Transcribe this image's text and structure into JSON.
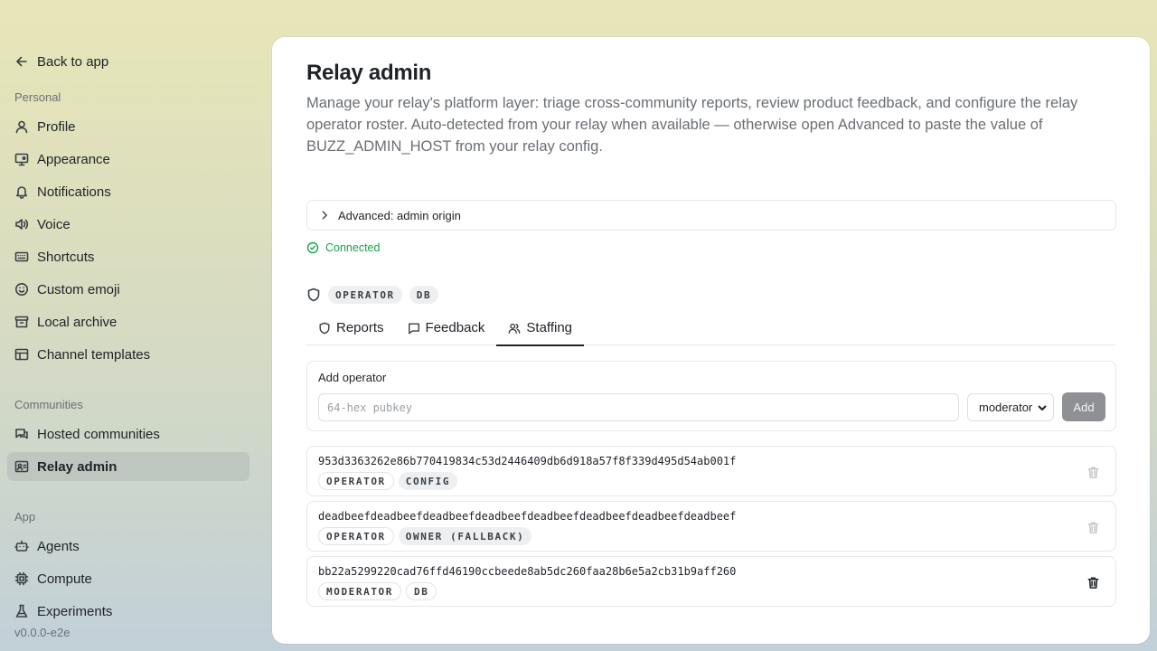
{
  "sidebar": {
    "back_label": "Back to app",
    "sections": [
      {
        "label": "Personal"
      },
      {
        "label": "Communities"
      },
      {
        "label": "App"
      }
    ],
    "personal_items": [
      {
        "label": "Profile",
        "icon": "user-icon"
      },
      {
        "label": "Appearance",
        "icon": "monitor-icon"
      },
      {
        "label": "Notifications",
        "icon": "bell-icon"
      },
      {
        "label": "Voice",
        "icon": "volume-icon"
      },
      {
        "label": "Shortcuts",
        "icon": "keyboard-icon"
      },
      {
        "label": "Custom emoji",
        "icon": "smile-icon"
      },
      {
        "label": "Local archive",
        "icon": "archive-icon"
      },
      {
        "label": "Channel templates",
        "icon": "layout-icon"
      }
    ],
    "community_items": [
      {
        "label": "Hosted communities",
        "icon": "chat-icon"
      },
      {
        "label": "Relay admin",
        "icon": "admin-icon",
        "active": true
      }
    ],
    "app_items": [
      {
        "label": "Agents",
        "icon": "bot-icon"
      },
      {
        "label": "Compute",
        "icon": "cpu-icon"
      },
      {
        "label": "Experiments",
        "icon": "flask-icon"
      }
    ],
    "version": "v0.0.0-e2e"
  },
  "main": {
    "title": "Relay admin",
    "description": "Manage your relay's platform layer: triage cross-community reports, review product feedback, and configure the relay operator roster. Auto-detected from your relay when available — otherwise open Advanced to paste the value of BUZZ_ADMIN_HOST from your relay config.",
    "advanced_label": "Advanced: admin origin",
    "status_text": "Connected",
    "status_color": "#16a34a",
    "my_roles": [
      "OPERATOR",
      "DB"
    ],
    "tabs": [
      {
        "label": "Reports",
        "icon": "shield-icon"
      },
      {
        "label": "Feedback",
        "icon": "message-icon"
      },
      {
        "label": "Staffing",
        "icon": "users-icon",
        "active": true
      }
    ],
    "add_operator": {
      "label": "Add operator",
      "placeholder": "64-hex pubkey",
      "role_value": "moderator",
      "add_label": "Add"
    },
    "operators": [
      {
        "pubkey": "953d3363262e86b770419834c53d2446409db6d918a57f8f339d495d54ab001f",
        "badges": [
          "OPERATOR",
          "CONFIG"
        ],
        "delete_enabled": false
      },
      {
        "pubkey": "deadbeefdeadbeefdeadbeefdeadbeefdeadbeefdeadbeefdeadbeefdeadbeef",
        "badges": [
          "OPERATOR",
          "OWNER (FALLBACK)"
        ],
        "delete_enabled": false
      },
      {
        "pubkey": "bb22a5299220cad76ffd46190ccbeede8ab5dc260faa28b6e5a2cb31b9aff260",
        "badges": [
          "MODERATOR",
          "DB"
        ],
        "delete_enabled": true
      }
    ]
  }
}
